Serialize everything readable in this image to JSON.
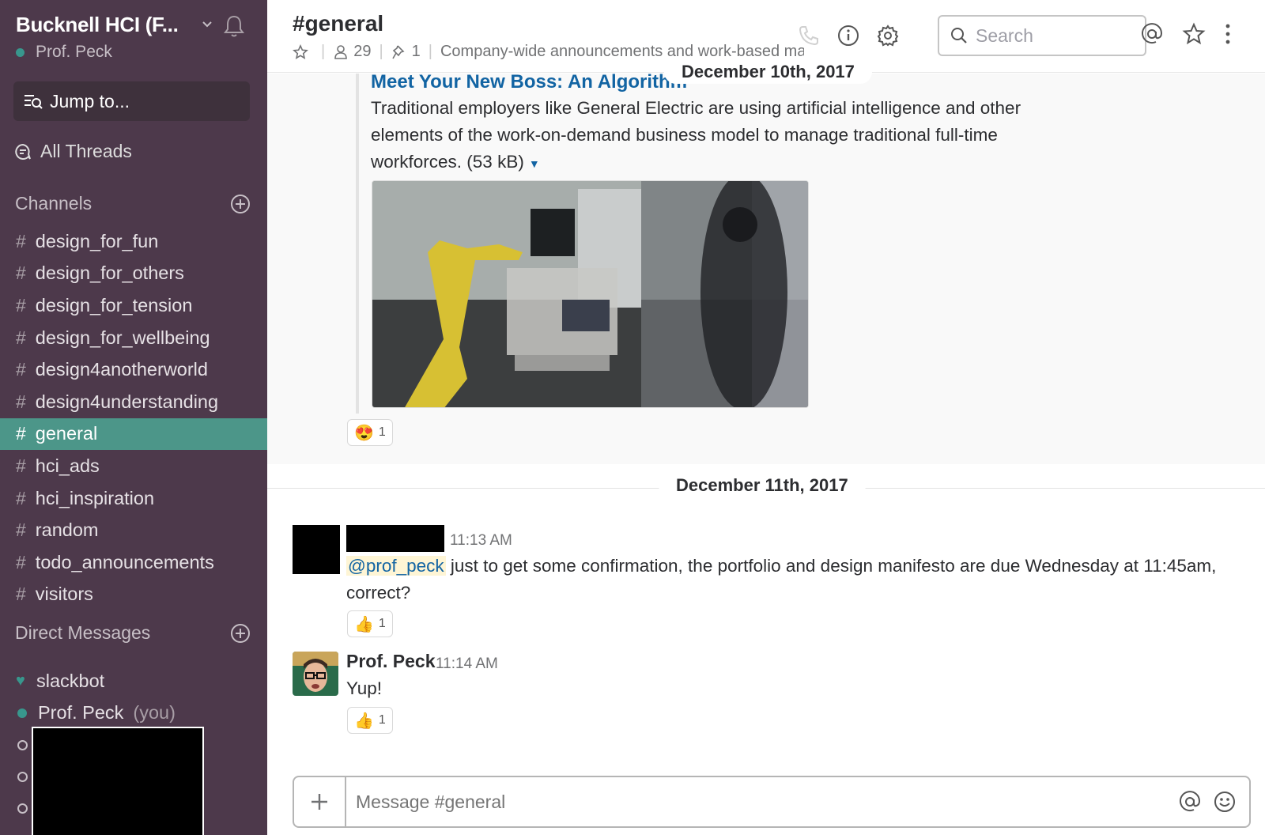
{
  "sidebar": {
    "team_name": "Bucknell HCI (F...",
    "user_name": "Prof. Peck",
    "jump_to": "Jump to...",
    "all_threads": "All Threads",
    "channels_header": "Channels",
    "channels": [
      {
        "name": "design_for_fun"
      },
      {
        "name": "design_for_others"
      },
      {
        "name": "design_for_tension"
      },
      {
        "name": "design_for_wellbeing"
      },
      {
        "name": "design4anotherworld"
      },
      {
        "name": "design4understanding"
      },
      {
        "name": "general",
        "active": true
      },
      {
        "name": "hci_ads"
      },
      {
        "name": "hci_inspiration"
      },
      {
        "name": "random"
      },
      {
        "name": "todo_announcements"
      },
      {
        "name": "visitors"
      }
    ],
    "hash": "#",
    "dm_header": "Direct Messages",
    "dms": {
      "slackbot": "slackbot",
      "self_name": "Prof. Peck",
      "self_tag": "(you)"
    }
  },
  "header": {
    "channel_title": "#general",
    "member_count": "29",
    "pinned_count": "1",
    "topic": "Company-wide announcements and work-based ma",
    "search_placeholder": "Search"
  },
  "messages": {
    "date_1": "December 10th, 2017",
    "attachment": {
      "title": "Meet Your New Boss: An Algorithm",
      "description": "Traditional employers like General Electric are using artificial intelligence and other elements of the work-on-demand business model to manage traditional full-time workforces.",
      "size": "(53 kB)"
    },
    "reaction_1": {
      "emoji": "😍",
      "count": "1"
    },
    "date_2": "December 11th, 2017",
    "msg_1": {
      "time": "11:13 AM",
      "mention": "@prof_peck",
      "text": "just to get some confirmation, the portfolio and design manifesto are due Wednesday at 11:45am,",
      "text_cont": "correct?",
      "reaction": {
        "emoji": "👍",
        "count": "1"
      }
    },
    "msg_2": {
      "sender": "Prof. Peck",
      "time": "11:14 AM",
      "text": "Yup!",
      "reaction": {
        "emoji": "👍",
        "count": "1"
      }
    }
  },
  "composer": {
    "placeholder": "Message #general"
  },
  "colors": {
    "sidebar_bg": "#4d394b",
    "active_channel": "#4c9689",
    "link_blue": "#1264a3",
    "presence_green": "#38978d"
  }
}
